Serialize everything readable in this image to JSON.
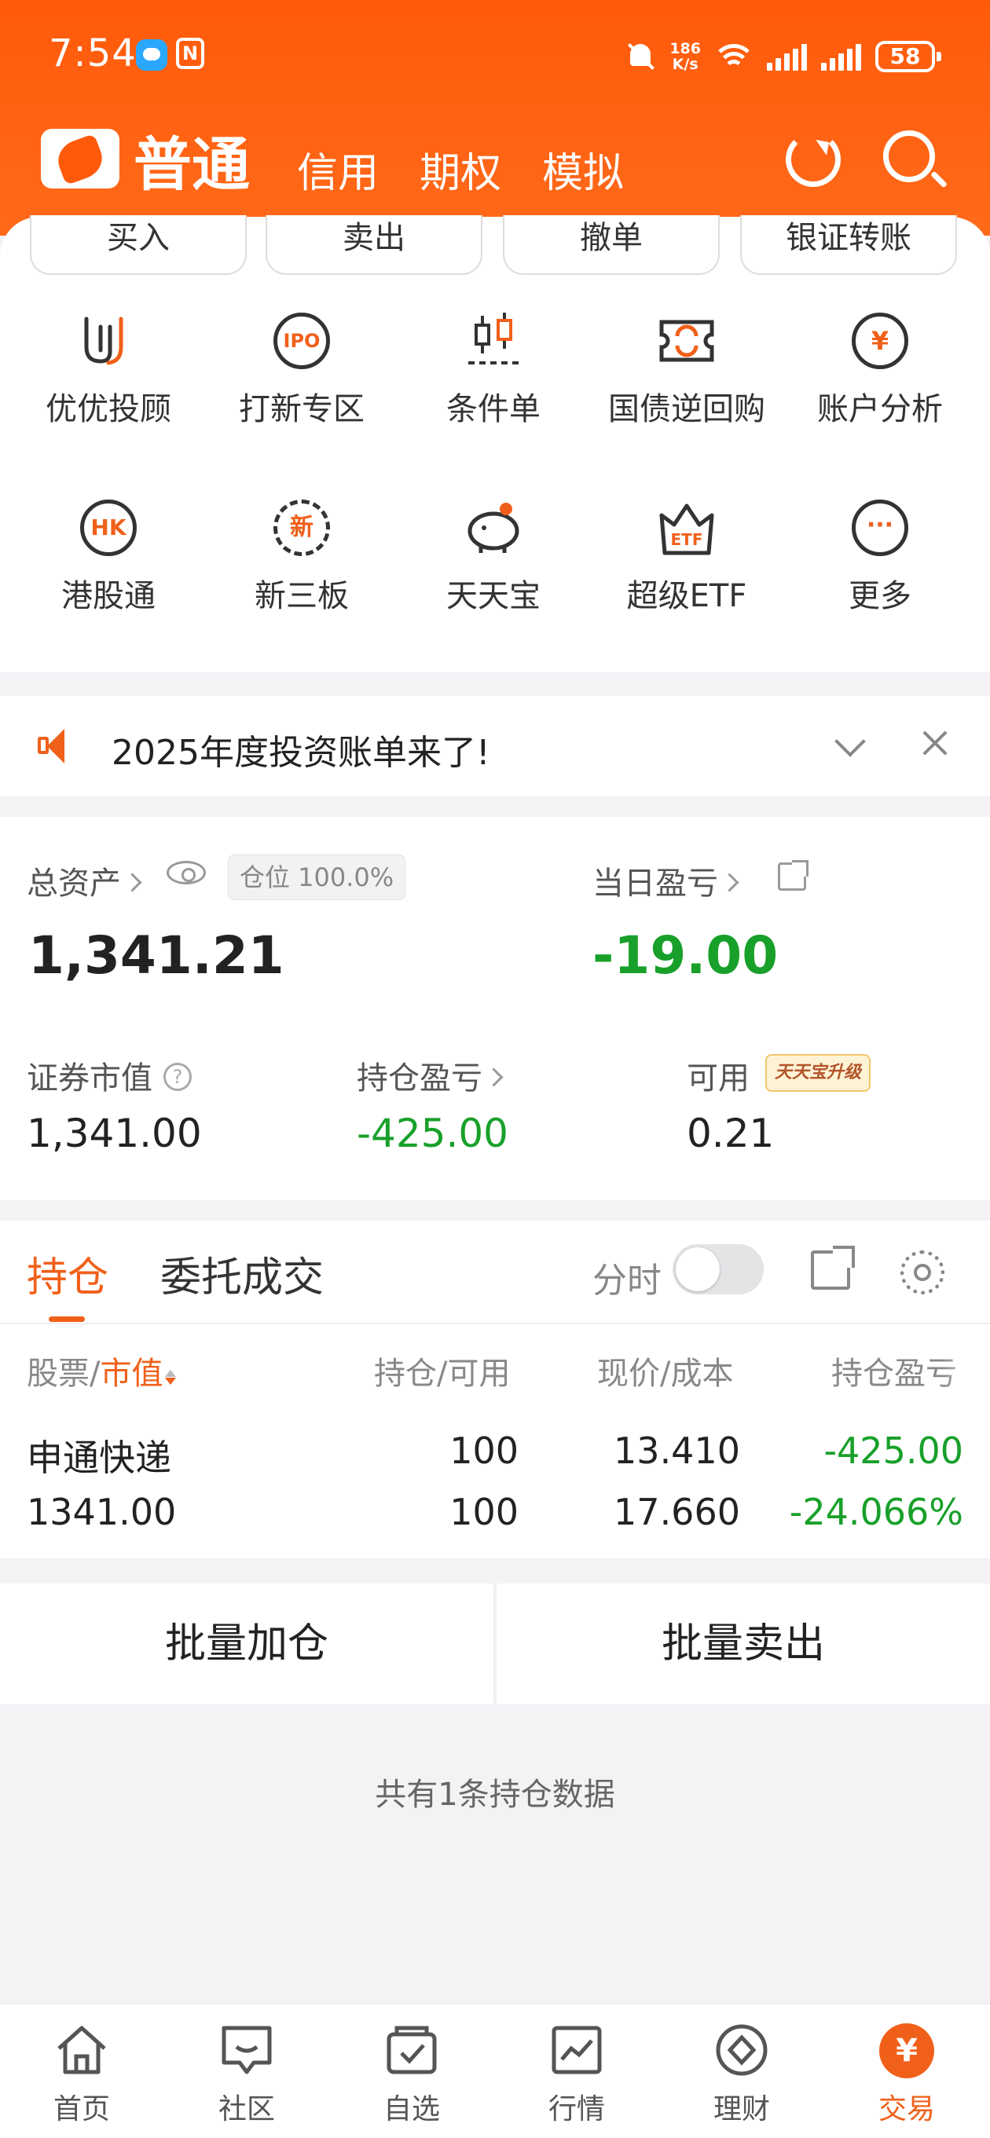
{
  "status_bar": {
    "time": "7:54",
    "net_speed": "186",
    "net_unit": "K/s",
    "battery": "58"
  },
  "header": {
    "tabs": [
      "普通",
      "信用",
      "期权",
      "模拟"
    ],
    "active_tab": "普通",
    "accent_color": "#ff5a0a"
  },
  "quick_actions": [
    "买入",
    "卖出",
    "撤单",
    "银证转账"
  ],
  "grid": [
    {
      "label": "优优投顾",
      "icon": "uu-advisor-icon"
    },
    {
      "label": "打新专区",
      "icon": "ipo-icon",
      "glyph": "IPO"
    },
    {
      "label": "条件单",
      "icon": "candlestick-icon"
    },
    {
      "label": "国债逆回购",
      "icon": "reverse-repo-icon"
    },
    {
      "label": "账户分析",
      "icon": "account-analysis-icon",
      "glyph": "¥"
    },
    {
      "label": "港股通",
      "icon": "hk-connect-icon",
      "glyph": "HK"
    },
    {
      "label": "新三板",
      "icon": "new-third-board-icon",
      "glyph": "新"
    },
    {
      "label": "天天宝",
      "icon": "piggy-bank-icon"
    },
    {
      "label": "超级ETF",
      "icon": "etf-icon",
      "glyph": "ETF"
    },
    {
      "label": "更多",
      "icon": "more-icon",
      "glyph": "···"
    }
  ],
  "notice": {
    "text": "2025年度投资账单来了!"
  },
  "assets": {
    "total_label": "总资产",
    "position_badge": "仓位 100.0%",
    "total_value": "1,341.21",
    "day_pl_label": "当日盈亏",
    "day_pl_value": "-19.00",
    "market_value_label": "证券市值",
    "market_value": "1,341.00",
    "holding_pl_label": "持仓盈亏",
    "holding_pl": "-425.00",
    "available_label": "可用",
    "ttb_badge": "天天宝升级",
    "available": "0.21"
  },
  "holdings": {
    "tab_holdings": "持仓",
    "tab_orders": "委托成交",
    "fenshi_label": "分时",
    "col_stock": "股票/",
    "col_mv": "市值",
    "col_qty": "持仓/可用",
    "col_price": "现价/成本",
    "col_pl": "持仓盈亏",
    "rows": [
      {
        "name": "申通快递",
        "market_value": "1341.00",
        "qty": "100",
        "available": "100",
        "price": "13.410",
        "cost": "17.660",
        "pl": "-425.00",
        "pl_pct": "-24.066%"
      }
    ],
    "bulk_add": "批量加仓",
    "bulk_sell": "批量卖出",
    "footer": "共有1条持仓数据"
  },
  "bottom_nav": [
    {
      "label": "首页",
      "icon": "home-icon"
    },
    {
      "label": "社区",
      "icon": "community-icon"
    },
    {
      "label": "自选",
      "icon": "watchlist-icon"
    },
    {
      "label": "行情",
      "icon": "market-icon"
    },
    {
      "label": "理财",
      "icon": "wealth-icon"
    },
    {
      "label": "交易",
      "icon": "trade-icon",
      "glyph": "¥",
      "active": true
    }
  ]
}
